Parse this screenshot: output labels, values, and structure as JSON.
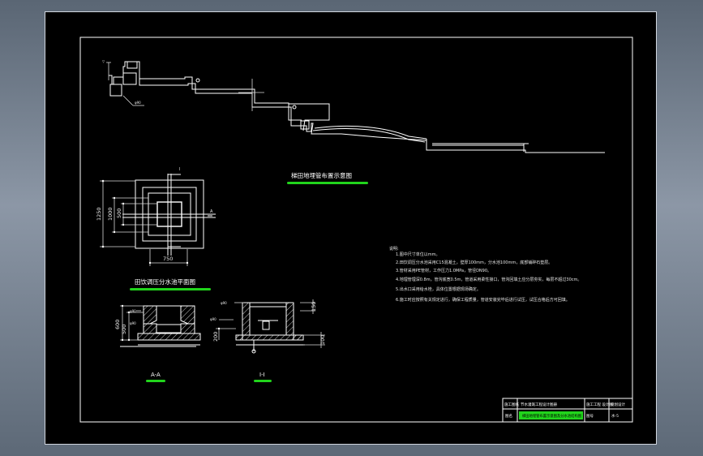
{
  "drawing": {
    "profile_title": "梯田地埋管布置示意图",
    "plan_title": "田饮调压分水池平面图",
    "section_aa_label": "A-A",
    "section_ii_label": "I-I",
    "plan_dims": {
      "d1250": "1250",
      "d1000": "1000",
      "d500": "500",
      "d750": "750"
    },
    "section_dims": {
      "d600": "600",
      "d500": "500",
      "d200": "200",
      "d150": "150",
      "d100": "100"
    },
    "notes": {
      "heading": "说明:",
      "items": [
        "1.图中尺寸单位以mm。",
        "2.田饮调压分水池采用C15混凝土，壁厚100mm，分水池100mm，底部铺碎石垫层。",
        "3.管材采用PE管材，工作压力1.0MPa，管径DN90。",
        "4.地埋管埋深0.8m，管沟底宽0.5m，管道采用柔性接口，管沟回填土应分层夯实，每层不超过30cm。",
        "5.出水口采用给水栓，具体位置根据现场确定。",
        "6.施工时应按照有关规定进行，确保工程质量，管道安装完毕后进行试压，试压合格后方可回填。"
      ]
    },
    "title_block": {
      "row1_a": "施工图纸",
      "row1_b": "节水灌溉工程设计图册",
      "row1_c": "施工工程 设计图",
      "row1_d": "规划设计",
      "row2_a": "图名",
      "row2_b": "梯田地埋管布置示意图及分水池结构图",
      "row2_c": "图号",
      "row2_d": "水-5"
    },
    "colors": {
      "accent_green": "#21d41c",
      "line": "#ffffff",
      "background": "#000000"
    }
  }
}
